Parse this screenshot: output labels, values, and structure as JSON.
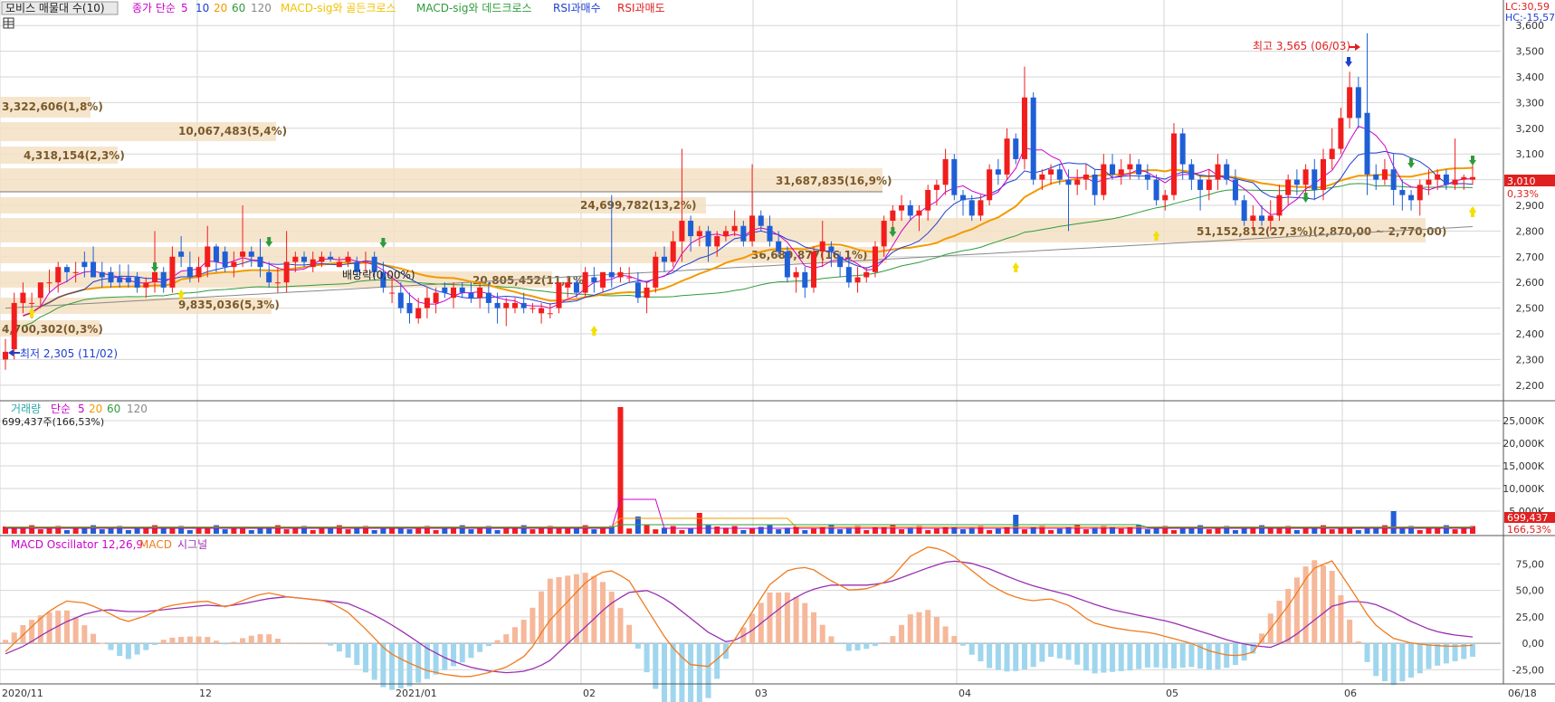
{
  "colors": {
    "up": "#f21d1d",
    "down": "#1f5fd6",
    "ma5": "#cc00cc",
    "ma10": "#1f3fd0",
    "ma20": "#f29a00",
    "ma60": "#2e9c3a",
    "ma120": "#888888",
    "macd": "#f07b1e",
    "signal": "#9a2fb2",
    "osc_pos": "#f6b89a",
    "osc_neg": "#9fd6ee",
    "band": "#f5e0c4",
    "last_price_bg": "#e02020",
    "grid": "#d6d6d6"
  },
  "legend": {
    "price": {
      "title": "모비스 매물대 수(10)",
      "ma_label": "종가 단순",
      "ma5": "5",
      "ma10": "10",
      "ma20": "20",
      "ma60": "60",
      "ma120": "120",
      "golden": "MACD-sig와 골든크로스",
      "dead": "MACD-sig와 데드크로스",
      "rsi_buy": "RSI과매수",
      "rsi_sell": "RSI과매도",
      "lc": "LC:30,59",
      "hc": "HC:-15,57"
    },
    "volume": {
      "title": "거래량",
      "ma_label": "단순",
      "ma5": "5",
      "ma20": "20",
      "ma60": "60",
      "ma120": "120",
      "current": "699,437주(166,53%)"
    },
    "macd": {
      "osc": "MACD Oscillator 12,26,9",
      "macd": "MACD",
      "signal": "시그널"
    }
  },
  "annotations": {
    "high": "최고 3,565 (06/03)",
    "low": "최저 2,305 (11/02)",
    "last_price": "3,010",
    "last_change": "0,33%",
    "last_volume": "699,437",
    "last_volume_pct": "166,53%",
    "exdiv": "배당락(0,00%)"
  },
  "chart_data": [
    {
      "type": "candlestick",
      "title": "모비스 매물대 수(10)",
      "ylim": [
        2150,
        3650
      ],
      "y_ticks": [
        "2,200",
        "2,300",
        "2,400",
        "2,500",
        "2,600",
        "2,700",
        "2,800",
        "2,900",
        "3,000",
        "3,100",
        "3,200",
        "3,300",
        "3,400",
        "3,500",
        "3,600"
      ],
      "x_ticks": [
        "2020/11",
        "12",
        "2021/01",
        "02",
        "03",
        "04",
        "05",
        "06",
        "06/18"
      ],
      "candles": [
        [
          2.3,
          2.38,
          2.26,
          2.33
        ],
        [
          2.34,
          2.56,
          2.3,
          2.52
        ],
        [
          2.52,
          2.6,
          2.48,
          2.56
        ],
        [
          2.52,
          2.56,
          2.46,
          2.52
        ],
        [
          2.54,
          2.6,
          2.5,
          2.6
        ],
        [
          2.6,
          2.65,
          2.56,
          2.6
        ],
        [
          2.6,
          2.68,
          2.56,
          2.66
        ],
        [
          2.66,
          2.67,
          2.6,
          2.64
        ],
        [
          2.64,
          2.68,
          2.6,
          2.64
        ],
        [
          2.68,
          2.72,
          2.62,
          2.66
        ],
        [
          2.68,
          2.74,
          2.62,
          2.62
        ],
        [
          2.64,
          2.68,
          2.58,
          2.62
        ],
        [
          2.64,
          2.66,
          2.58,
          2.6
        ],
        [
          2.62,
          2.67,
          2.58,
          2.6
        ],
        [
          2.62,
          2.67,
          2.58,
          2.6
        ],
        [
          2.62,
          2.64,
          2.56,
          2.58
        ],
        [
          2.58,
          2.62,
          2.54,
          2.6
        ],
        [
          2.6,
          2.8,
          2.56,
          2.64
        ],
        [
          2.64,
          2.66,
          2.56,
          2.58
        ],
        [
          2.58,
          2.74,
          2.56,
          2.7
        ],
        [
          2.72,
          2.78,
          2.66,
          2.7
        ],
        [
          2.66,
          2.72,
          2.6,
          2.62
        ],
        [
          2.62,
          2.7,
          2.6,
          2.66
        ],
        [
          2.66,
          2.82,
          2.62,
          2.74
        ],
        [
          2.74,
          2.75,
          2.64,
          2.68
        ],
        [
          2.72,
          2.74,
          2.64,
          2.66
        ],
        [
          2.66,
          2.72,
          2.62,
          2.68
        ],
        [
          2.7,
          2.9,
          2.66,
          2.72
        ],
        [
          2.72,
          2.74,
          2.66,
          2.7
        ],
        [
          2.7,
          2.77,
          2.62,
          2.66
        ],
        [
          2.64,
          2.68,
          2.58,
          2.6
        ],
        [
          2.6,
          2.66,
          2.56,
          2.6
        ],
        [
          2.6,
          2.8,
          2.56,
          2.68
        ],
        [
          2.68,
          2.72,
          2.64,
          2.7
        ],
        [
          2.7,
          2.72,
          2.66,
          2.68
        ],
        [
          2.66,
          2.72,
          2.64,
          2.69
        ],
        [
          2.68,
          2.72,
          2.66,
          2.7
        ],
        [
          2.7,
          2.72,
          2.68,
          2.69
        ],
        [
          2.66,
          2.7,
          2.66,
          2.68
        ],
        [
          2.68,
          2.72,
          2.66,
          2.7
        ],
        [
          2.68,
          2.7,
          2.62,
          2.64
        ],
        [
          2.68,
          2.72,
          2.64,
          2.68
        ],
        [
          2.7,
          2.72,
          2.62,
          2.64
        ],
        [
          2.64,
          2.68,
          2.56,
          2.58
        ],
        [
          2.56,
          2.62,
          2.52,
          2.56
        ],
        [
          2.56,
          2.6,
          2.48,
          2.5
        ],
        [
          2.52,
          2.56,
          2.44,
          2.48
        ],
        [
          2.46,
          2.54,
          2.44,
          2.5
        ],
        [
          2.5,
          2.58,
          2.46,
          2.54
        ],
        [
          2.52,
          2.58,
          2.48,
          2.56
        ],
        [
          2.58,
          2.6,
          2.54,
          2.56
        ],
        [
          2.54,
          2.6,
          2.5,
          2.58
        ],
        [
          2.58,
          2.6,
          2.54,
          2.56
        ],
        [
          2.56,
          2.6,
          2.52,
          2.54
        ],
        [
          2.54,
          2.6,
          2.5,
          2.58
        ],
        [
          2.56,
          2.6,
          2.48,
          2.52
        ],
        [
          2.52,
          2.56,
          2.44,
          2.5
        ],
        [
          2.5,
          2.54,
          2.43,
          2.52
        ],
        [
          2.5,
          2.54,
          2.48,
          2.52
        ],
        [
          2.52,
          2.56,
          2.48,
          2.5
        ],
        [
          2.5,
          2.52,
          2.48,
          2.5
        ],
        [
          2.48,
          2.52,
          2.44,
          2.5
        ],
        [
          2.48,
          2.52,
          2.46,
          2.48
        ],
        [
          2.5,
          2.6,
          2.48,
          2.6
        ],
        [
          2.58,
          2.62,
          2.54,
          2.6
        ],
        [
          2.6,
          2.62,
          2.54,
          2.56
        ],
        [
          2.56,
          2.66,
          2.54,
          2.64
        ],
        [
          2.62,
          2.66,
          2.56,
          2.6
        ],
        [
          2.58,
          2.64,
          2.56,
          2.64
        ],
        [
          2.64,
          2.94,
          2.58,
          2.62
        ],
        [
          2.62,
          2.66,
          2.6,
          2.64
        ],
        [
          2.62,
          2.66,
          2.6,
          2.62
        ],
        [
          2.6,
          2.64,
          2.52,
          2.54
        ],
        [
          2.54,
          2.6,
          2.48,
          2.58
        ],
        [
          2.58,
          2.72,
          2.56,
          2.7
        ],
        [
          2.7,
          2.74,
          2.64,
          2.68
        ],
        [
          2.68,
          2.8,
          2.66,
          2.76
        ],
        [
          2.76,
          3.12,
          2.68,
          2.84
        ],
        [
          2.84,
          2.86,
          2.72,
          2.78
        ],
        [
          2.78,
          2.82,
          2.74,
          2.8
        ],
        [
          2.8,
          2.82,
          2.68,
          2.74
        ],
        [
          2.74,
          2.8,
          2.7,
          2.78
        ],
        [
          2.78,
          2.82,
          2.76,
          2.8
        ],
        [
          2.8,
          2.88,
          2.78,
          2.82
        ],
        [
          2.82,
          2.84,
          2.74,
          2.76
        ],
        [
          2.76,
          3.06,
          2.74,
          2.86
        ],
        [
          2.86,
          2.88,
          2.8,
          2.82
        ],
        [
          2.82,
          2.86,
          2.74,
          2.76
        ],
        [
          2.76,
          2.8,
          2.7,
          2.72
        ],
        [
          2.72,
          2.74,
          2.6,
          2.62
        ],
        [
          2.62,
          2.66,
          2.56,
          2.64
        ],
        [
          2.64,
          2.66,
          2.54,
          2.58
        ],
        [
          2.58,
          2.74,
          2.56,
          2.72
        ],
        [
          2.72,
          2.84,
          2.66,
          2.76
        ],
        [
          2.74,
          2.76,
          2.66,
          2.72
        ],
        [
          2.7,
          2.72,
          2.62,
          2.66
        ],
        [
          2.66,
          2.7,
          2.58,
          2.6
        ],
        [
          2.6,
          2.66,
          2.56,
          2.62
        ],
        [
          2.62,
          2.66,
          2.6,
          2.64
        ],
        [
          2.64,
          2.76,
          2.62,
          2.74
        ],
        [
          2.74,
          2.86,
          2.7,
          2.84
        ],
        [
          2.84,
          2.9,
          2.8,
          2.88
        ],
        [
          2.88,
          2.94,
          2.84,
          2.9
        ],
        [
          2.9,
          2.92,
          2.84,
          2.86
        ],
        [
          2.86,
          2.9,
          2.8,
          2.88
        ],
        [
          2.88,
          2.98,
          2.84,
          2.96
        ],
        [
          2.96,
          3.0,
          2.9,
          2.98
        ],
        [
          2.98,
          3.12,
          2.94,
          3.08
        ],
        [
          3.08,
          3.1,
          2.92,
          2.94
        ],
        [
          2.94,
          2.96,
          2.86,
          2.92
        ],
        [
          2.92,
          2.94,
          2.84,
          2.86
        ],
        [
          2.86,
          2.94,
          2.84,
          2.92
        ],
        [
          2.92,
          3.06,
          2.9,
          3.04
        ],
        [
          3.04,
          3.08,
          2.98,
          3.02
        ],
        [
          3.02,
          3.2,
          3.0,
          3.16
        ],
        [
          3.16,
          3.18,
          3.06,
          3.08
        ],
        [
          3.08,
          3.44,
          3.04,
          3.32
        ],
        [
          3.32,
          3.34,
          2.98,
          3.0
        ],
        [
          3.0,
          3.04,
          2.96,
          3.02
        ],
        [
          3.02,
          3.06,
          2.98,
          3.04
        ],
        [
          3.04,
          3.06,
          2.98,
          3.0
        ],
        [
          3.0,
          3.04,
          2.8,
          2.98
        ],
        [
          2.98,
          3.04,
          2.94,
          3.0
        ],
        [
          3.0,
          3.06,
          2.96,
          3.02
        ],
        [
          3.02,
          3.04,
          2.9,
          2.94
        ],
        [
          2.94,
          3.1,
          2.92,
          3.06
        ],
        [
          3.06,
          3.1,
          3.0,
          3.02
        ],
        [
          3.02,
          3.08,
          2.98,
          3.04
        ],
        [
          3.04,
          3.1,
          3.0,
          3.06
        ],
        [
          3.06,
          3.08,
          3.0,
          3.02
        ],
        [
          3.02,
          3.06,
          2.96,
          3.0
        ],
        [
          3.0,
          3.02,
          2.9,
          2.92
        ],
        [
          2.92,
          2.96,
          2.88,
          2.94
        ],
        [
          2.94,
          3.22,
          2.92,
          3.18
        ],
        [
          3.18,
          3.2,
          3.0,
          3.06
        ],
        [
          3.06,
          3.08,
          2.96,
          3.0
        ],
        [
          3.0,
          3.02,
          2.88,
          2.96
        ],
        [
          2.96,
          3.04,
          2.92,
          3.0
        ],
        [
          3.0,
          3.1,
          2.96,
          3.06
        ],
        [
          3.06,
          3.08,
          2.98,
          3.0
        ],
        [
          3.0,
          3.04,
          2.9,
          2.92
        ],
        [
          2.92,
          2.94,
          2.82,
          2.84
        ],
        [
          2.84,
          2.9,
          2.8,
          2.86
        ],
        [
          2.86,
          2.9,
          2.82,
          2.84
        ],
        [
          2.84,
          2.92,
          2.8,
          2.86
        ],
        [
          2.86,
          2.98,
          2.84,
          2.94
        ],
        [
          2.94,
          3.02,
          2.9,
          3.0
        ],
        [
          3.0,
          3.04,
          2.94,
          2.98
        ],
        [
          2.98,
          3.06,
          2.94,
          3.04
        ],
        [
          3.04,
          3.08,
          2.92,
          2.96
        ],
        [
          2.96,
          3.12,
          2.92,
          3.08
        ],
        [
          3.08,
          3.2,
          3.04,
          3.12
        ],
        [
          3.12,
          3.28,
          3.1,
          3.24
        ],
        [
          3.24,
          3.42,
          3.2,
          3.36
        ],
        [
          3.36,
          3.4,
          3.2,
          3.24
        ],
        [
          3.26,
          3.57,
          2.94,
          3.02
        ],
        [
          3.02,
          3.06,
          2.96,
          3.0
        ],
        [
          3.0,
          3.08,
          2.98,
          3.04
        ],
        [
          3.04,
          3.1,
          2.9,
          2.96
        ],
        [
          2.96,
          3.0,
          2.88,
          2.94
        ],
        [
          2.94,
          2.96,
          2.88,
          2.92
        ],
        [
          2.92,
          3.0,
          2.86,
          2.98
        ],
        [
          2.98,
          3.04,
          2.94,
          3.0
        ],
        [
          3.0,
          3.04,
          2.96,
          3.02
        ],
        [
          3.02,
          3.04,
          2.96,
          2.98
        ],
        [
          2.98,
          3.16,
          2.96,
          3.0
        ],
        [
          3.0,
          3.02,
          2.96,
          3.01
        ],
        [
          3.0,
          3.06,
          2.98,
          3.01
        ]
      ],
      "annotations": [
        "최고 3,565 (06/03)",
        "최저 2,305 (11/02)",
        "배당락(0,00%)"
      ]
    },
    {
      "type": "bar",
      "title": "거래량",
      "y_ticks": [
        "5,000K",
        "10,000K",
        "15,000K",
        "20,000K",
        "25,000K"
      ],
      "ylim": [
        0,
        28000
      ],
      "spike": {
        "x": "02",
        "value": 28000
      },
      "current": "699,437주(166,53%)"
    },
    {
      "type": "line",
      "title": "MACD Oscillator 12,26,9",
      "y_ticks": [
        "-25,00",
        "0,00",
        "25,00",
        "50,00",
        "75,00"
      ],
      "ylim": [
        -35,
        95
      ],
      "series": [
        {
          "name": "MACD",
          "values": [
            -8,
            10,
            28,
            40,
            38,
            30,
            20,
            26,
            35,
            38,
            40,
            34,
            42,
            48,
            44,
            42,
            40,
            30,
            12,
            -8,
            -18,
            -26,
            -30,
            -32,
            -28,
            -22,
            -10,
            20,
            40,
            60,
            70,
            60,
            30,
            0,
            -20,
            -22,
            -5,
            25,
            55,
            70,
            72,
            60,
            50,
            52,
            60,
            82,
            92,
            85,
            70,
            55,
            45,
            40,
            42,
            35,
            20,
            15,
            12,
            10,
            5,
            0,
            -8,
            -12,
            -10,
            15,
            40,
            70,
            78,
            50,
            20,
            5,
            0,
            -2,
            -3,
            -2
          ]
        },
        {
          "name": "시그널",
          "values": [
            -10,
            -2,
            10,
            20,
            28,
            32,
            30,
            30,
            32,
            34,
            36,
            35,
            38,
            42,
            44,
            42,
            40,
            38,
            30,
            20,
            8,
            -5,
            -15,
            -22,
            -26,
            -28,
            -26,
            -18,
            0,
            18,
            36,
            48,
            50,
            40,
            25,
            10,
            0,
            10,
            25,
            40,
            50,
            55,
            55,
            55,
            58,
            65,
            72,
            78,
            76,
            70,
            62,
            55,
            50,
            45,
            38,
            32,
            28,
            24,
            20,
            14,
            8,
            2,
            -2,
            -4,
            5,
            20,
            35,
            40,
            38,
            30,
            20,
            12,
            8,
            6
          ]
        }
      ]
    }
  ]
}
